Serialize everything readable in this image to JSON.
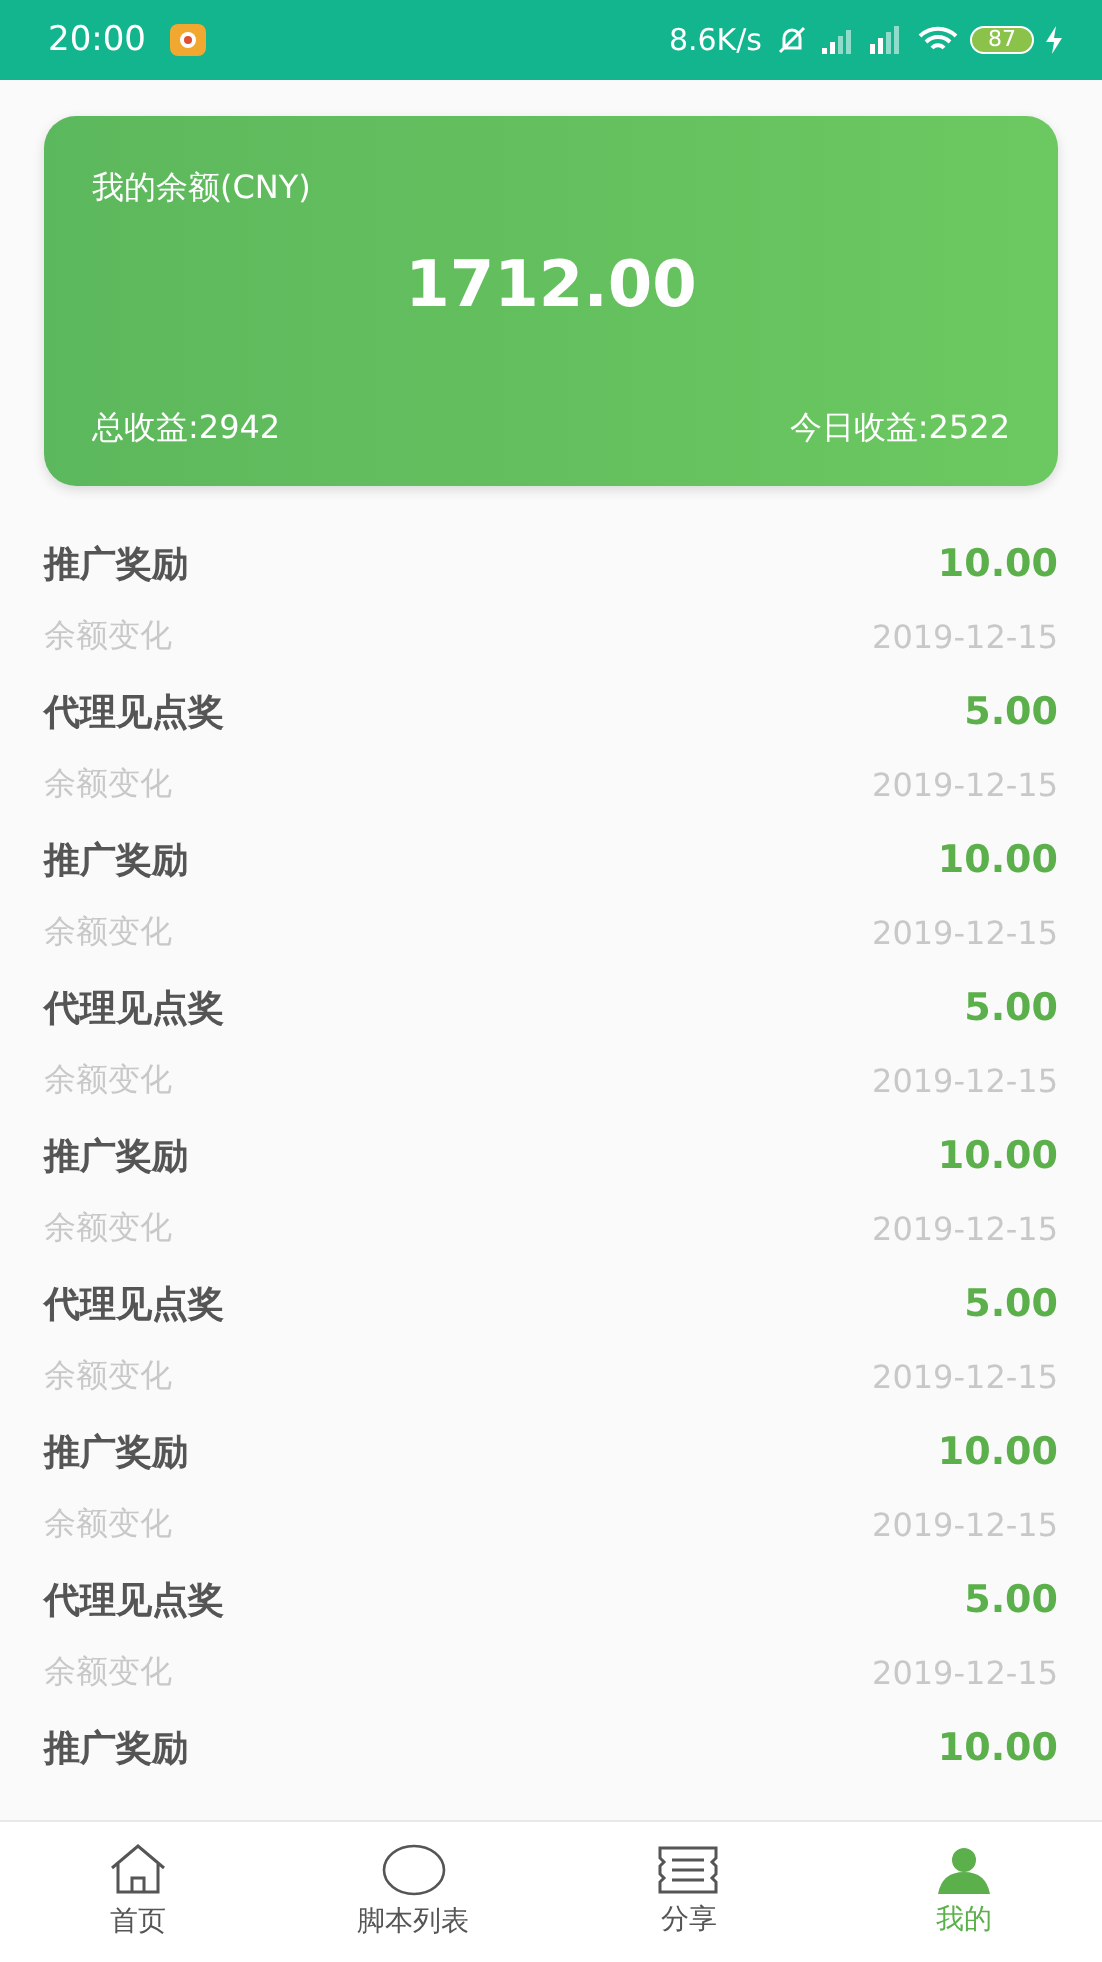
{
  "status_bar": {
    "time": "20:00",
    "speed": "8.6K/s",
    "battery": "87"
  },
  "balance_card": {
    "title": "我的余额(CNY)",
    "amount": "1712.00",
    "total_label": "总收益:2942",
    "today_label": "今日收益:2522"
  },
  "records": [
    {
      "title": "推广奖励",
      "amount": "10.00",
      "note": "余额变化",
      "date": "2019-12-15"
    },
    {
      "title": "代理见点奖",
      "amount": "5.00",
      "note": "余额变化",
      "date": "2019-12-15"
    },
    {
      "title": "推广奖励",
      "amount": "10.00",
      "note": "余额变化",
      "date": "2019-12-15"
    },
    {
      "title": "代理见点奖",
      "amount": "5.00",
      "note": "余额变化",
      "date": "2019-12-15"
    },
    {
      "title": "推广奖励",
      "amount": "10.00",
      "note": "余额变化",
      "date": "2019-12-15"
    },
    {
      "title": "代理见点奖",
      "amount": "5.00",
      "note": "余额变化",
      "date": "2019-12-15"
    },
    {
      "title": "推广奖励",
      "amount": "10.00",
      "note": "余额变化",
      "date": "2019-12-15"
    },
    {
      "title": "代理见点奖",
      "amount": "5.00",
      "note": "余额变化",
      "date": "2019-12-15"
    },
    {
      "title": "推广奖励",
      "amount": "10.00"
    }
  ],
  "tab_bar": [
    {
      "label": "首页",
      "kind": "home",
      "selected": false
    },
    {
      "label": "脚本列表",
      "kind": "oval",
      "selected": false
    },
    {
      "label": "分享",
      "kind": "ticket",
      "selected": false
    },
    {
      "label": "我的",
      "kind": "person",
      "selected": true
    }
  ]
}
